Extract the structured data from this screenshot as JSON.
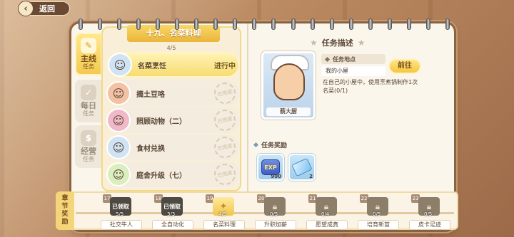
{
  "header": {
    "back_label": "返回"
  },
  "side_tabs": [
    {
      "label": "主线",
      "sub": "任务"
    },
    {
      "label": "每日",
      "sub": "任务"
    },
    {
      "label": "经营",
      "sub": "任务"
    }
  ],
  "chapter": {
    "title": "十九、名菜料理",
    "progress": "4/5",
    "quests": [
      {
        "name": "名菜烹饪",
        "status": "进行中"
      },
      {
        "name": "摘土豆咯",
        "status": "已完成"
      },
      {
        "name": "照顾动物（二）",
        "status": "已完成"
      },
      {
        "name": "食材兑换",
        "status": "已完成"
      },
      {
        "name": "庭舍升级（七）",
        "status": "已完成"
      }
    ]
  },
  "task": {
    "heading": "任务描述",
    "npc_name": "蔡大厨",
    "location_label": "任务地点",
    "location_value": "我的小屋",
    "goto_label": "前往",
    "description": "在自己的小屋中，使用烹煮锅制作1次名菜(0/1)",
    "reward_heading": "任务奖励",
    "rewards": [
      {
        "icon": "exp-icon",
        "label": "EXP",
        "count": "900"
      },
      {
        "icon": "ticket-icon",
        "count": "2"
      }
    ]
  },
  "chapter_bar": {
    "label": "章节奖励",
    "chapters": [
      {
        "num": "17",
        "name": "社交牛人",
        "state": "已领取",
        "prog": "5/5"
      },
      {
        "num": "18",
        "name": "全自动化",
        "state": "已领取",
        "prog": "3/3"
      },
      {
        "num": "19",
        "name": "名菜料理",
        "state": "",
        "prog": "4/5"
      },
      {
        "num": "20",
        "name": "升职加薪",
        "state": "",
        "prog": "0/5"
      },
      {
        "num": "21",
        "name": "愿望成真",
        "state": "",
        "prog": "0/4"
      },
      {
        "num": "22",
        "name": "培育新苗",
        "state": "",
        "prog": "0/5"
      },
      {
        "num": "23",
        "name": "皮卡足迹",
        "state": "",
        "prog": "0/5"
      }
    ]
  }
}
